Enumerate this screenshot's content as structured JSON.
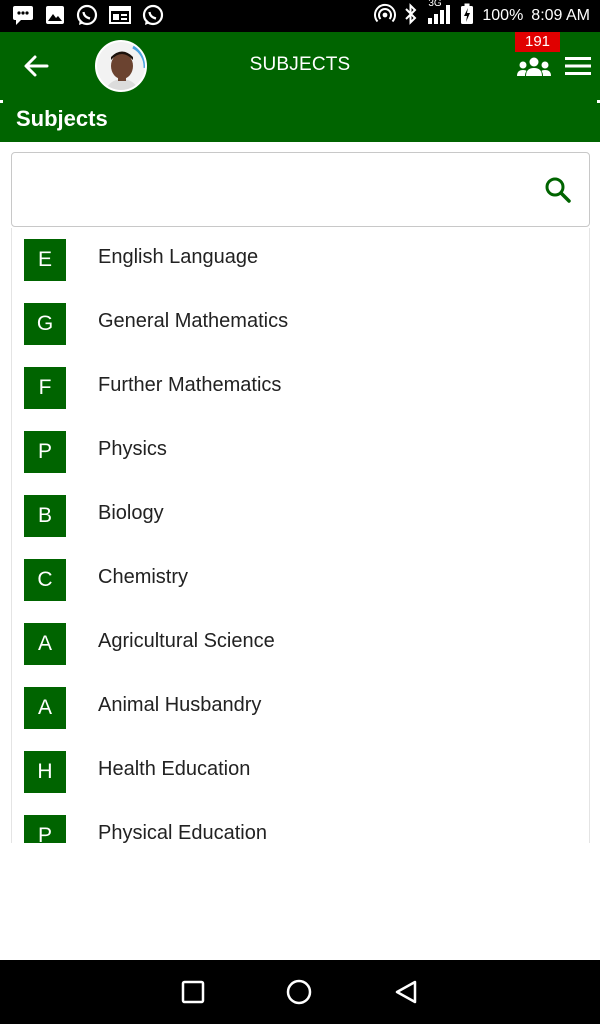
{
  "status_bar": {
    "battery": "100%",
    "time": "8:09 AM",
    "network": "3G",
    "left_icons": [
      "chat-notification-icon",
      "image-notification-icon",
      "whatsapp-icon",
      "news-icon",
      "whatsapp-icon"
    ],
    "right_icons": [
      "hotspot-icon",
      "bluetooth-icon",
      "signal-icon",
      "battery-charging-icon"
    ]
  },
  "app_bar": {
    "title": "SUBJECTS",
    "badge_count": "191",
    "back_icon": "arrow-left-icon",
    "group_icon": "group-icon",
    "menu_icon": "hamburger-menu-icon",
    "color": "#006400"
  },
  "sub_header": {
    "title": "Subjects"
  },
  "search": {
    "value": "",
    "placeholder": "",
    "icon": "search-icon"
  },
  "subjects": [
    {
      "letter": "E",
      "name": "English Language"
    },
    {
      "letter": "G",
      "name": "General Mathematics"
    },
    {
      "letter": "F",
      "name": "Further Mathematics"
    },
    {
      "letter": "P",
      "name": "Physics"
    },
    {
      "letter": "B",
      "name": "Biology"
    },
    {
      "letter": "C",
      "name": "Chemistry"
    },
    {
      "letter": "A",
      "name": "Agricultural Science"
    },
    {
      "letter": "A",
      "name": "Animal Husbandry"
    },
    {
      "letter": "H",
      "name": "Health Education"
    },
    {
      "letter": "P",
      "name": "Physical Education"
    }
  ],
  "nav_bar": {
    "icons": [
      "recents-square-icon",
      "home-circle-icon",
      "back-triangle-icon"
    ]
  }
}
